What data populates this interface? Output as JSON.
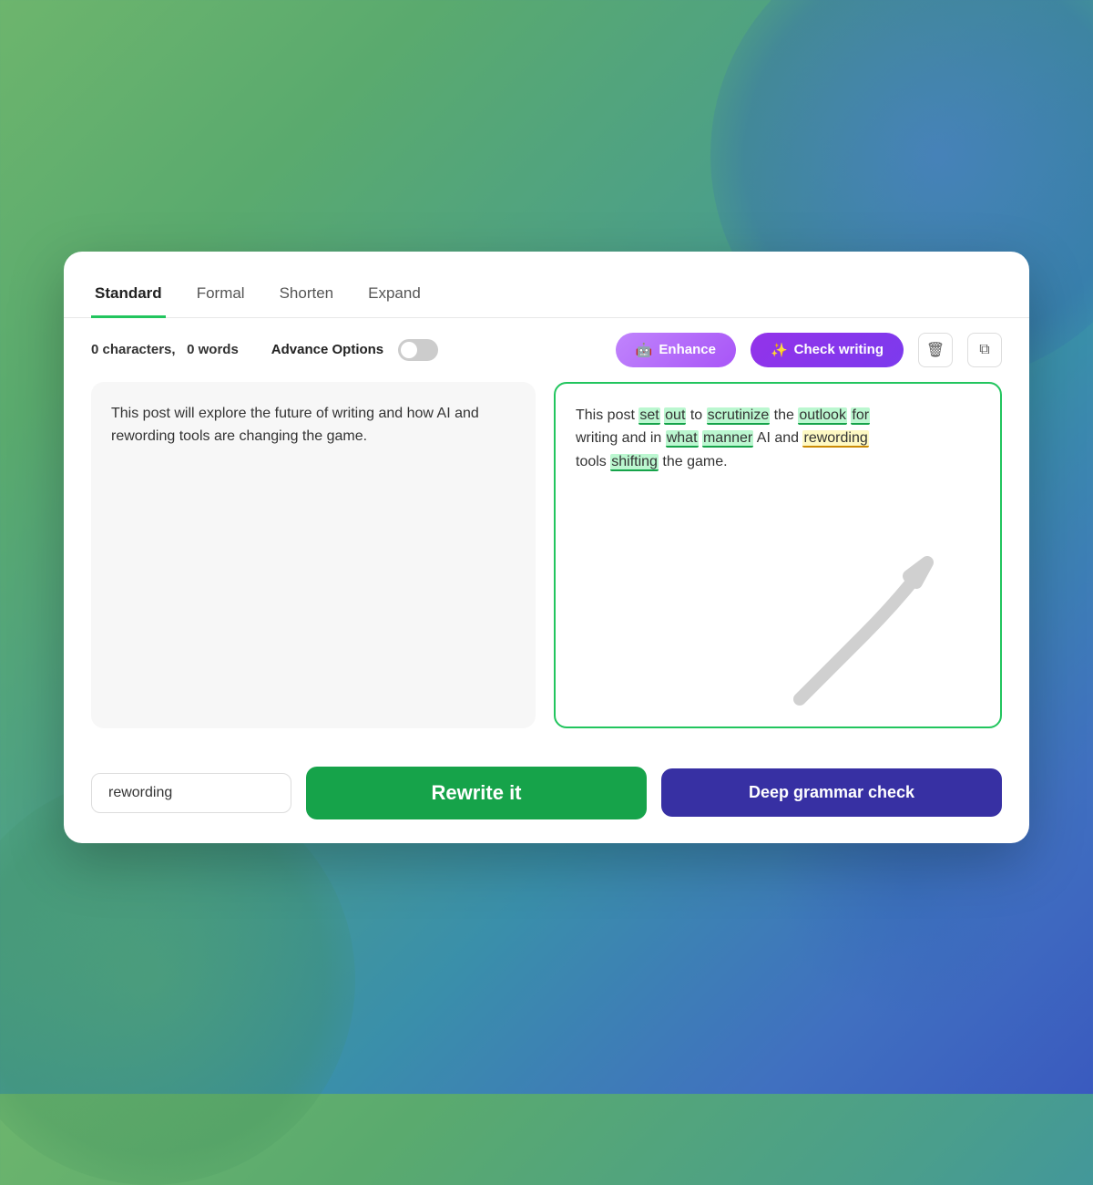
{
  "background": {
    "gradient_start": "#6db56d",
    "gradient_end": "#3a5abf"
  },
  "tabs": [
    {
      "label": "Standard",
      "active": true
    },
    {
      "label": "Formal",
      "active": false
    },
    {
      "label": "Shorten",
      "active": false
    },
    {
      "label": "Expand",
      "active": false
    }
  ],
  "toolbar": {
    "char_count": "0",
    "word_count": "0",
    "chars_label": "characters,",
    "words_label": "words",
    "advance_options_label": "Advance Options",
    "enhance_label": "Enhance",
    "check_writing_label": "Check writing"
  },
  "input_text": "This post will explore the future of writing and how AI and rewording tools are changing the game.",
  "output_text_parts": [
    {
      "text": "This post ",
      "highlight": null
    },
    {
      "text": "set",
      "highlight": "green"
    },
    {
      "text": " ",
      "highlight": null
    },
    {
      "text": "out",
      "highlight": "green"
    },
    {
      "text": " to ",
      "highlight": null
    },
    {
      "text": "scrutinize",
      "highlight": "green"
    },
    {
      "text": " the ",
      "highlight": null
    },
    {
      "text": "outlook",
      "highlight": "green"
    },
    {
      "text": " ",
      "highlight": null
    },
    {
      "text": "for",
      "highlight": "green"
    },
    {
      "text": "\nwriting and in ",
      "highlight": null
    },
    {
      "text": "what",
      "highlight": "green"
    },
    {
      "text": " ",
      "highlight": null
    },
    {
      "text": "manner",
      "highlight": "green"
    },
    {
      "text": " AI and ",
      "highlight": null
    },
    {
      "text": "rewording",
      "highlight": "yellow"
    },
    {
      "text": "\ntools ",
      "highlight": null
    },
    {
      "text": "shifting",
      "highlight": "green"
    },
    {
      "text": " the game.",
      "highlight": null
    }
  ],
  "bottom": {
    "rewording_placeholder": "rewording",
    "rewording_value": "rewording",
    "rewrite_btn": "Rewrite it",
    "grammar_btn": "Deep grammar check"
  }
}
